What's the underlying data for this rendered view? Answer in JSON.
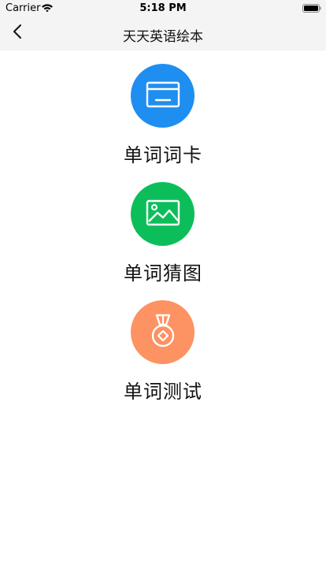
{
  "status_bar": {
    "carrier": "Carrier",
    "time": "5:18 PM"
  },
  "nav": {
    "title": "天天英语绘本",
    "back_icon": "chevron-left-icon"
  },
  "menu": [
    {
      "label": "单词词卡",
      "icon": "card-icon",
      "color": "#1f8ef1"
    },
    {
      "label": "单词猜图",
      "icon": "image-icon",
      "color": "#0cbe5a"
    },
    {
      "label": "单词测试",
      "icon": "medal-icon",
      "color": "#fd9263"
    }
  ],
  "colors": {
    "nav_background": "#f4f4f4",
    "background": "#ffffff"
  }
}
